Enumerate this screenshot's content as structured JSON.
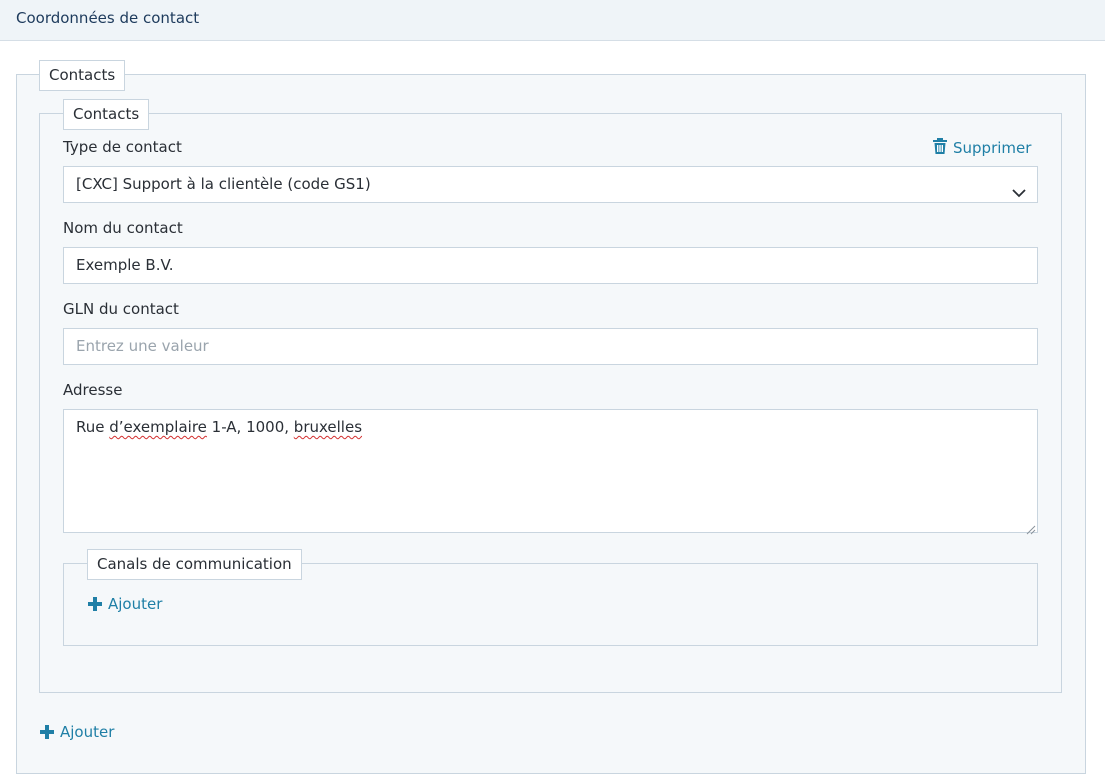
{
  "header": {
    "title": "Coordonnées de contact"
  },
  "outer_group": {
    "legend": "Contacts",
    "add_label": "Ajouter"
  },
  "contact": {
    "legend": "Contacts",
    "delete_label": "Supprimer",
    "type": {
      "label": "Type de contact",
      "selected": "[CXC] Support à la clientèle (code GS1)"
    },
    "name": {
      "label": "Nom du contact",
      "value": "Exemple B.V."
    },
    "gln": {
      "label": "GLN du contact",
      "placeholder": "Entrez une valeur",
      "value": ""
    },
    "address": {
      "label": "Adresse",
      "part1": "Rue ",
      "part2": "d’exemplaire",
      "part3": " 1-A, 1000, ",
      "part4": "bruxelles"
    },
    "channels": {
      "legend": "Canals de communication",
      "add_label": "Ajouter"
    }
  },
  "colors": {
    "accent": "#1f7fa6",
    "header_bg": "#eff4f8",
    "border": "#c9d5df"
  },
  "icons": {
    "delete": "trash-icon",
    "add": "plus-icon",
    "dropdown": "chevron-down-icon"
  }
}
